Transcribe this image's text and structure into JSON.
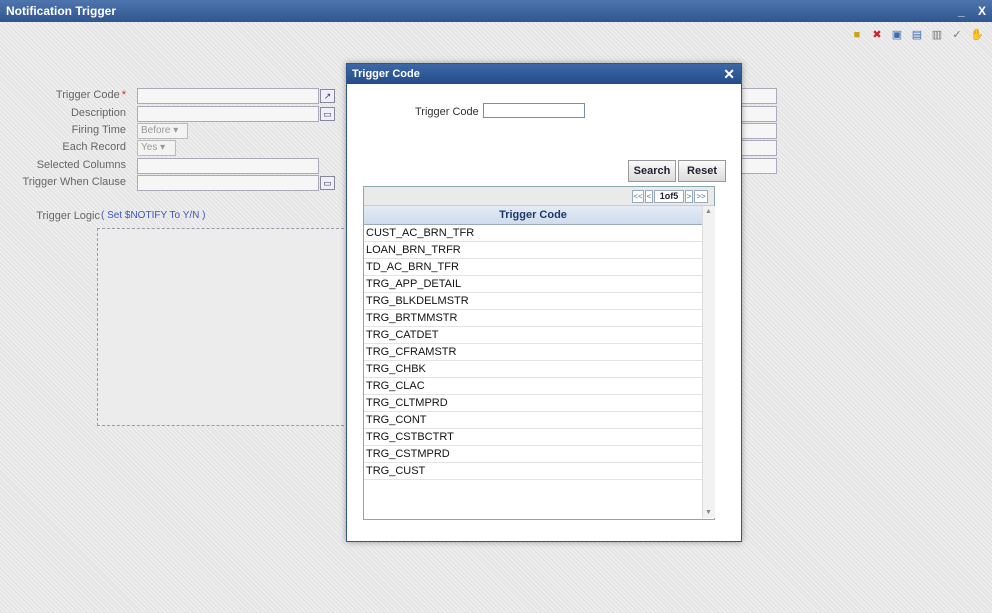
{
  "window": {
    "title": "Notification Trigger",
    "minimize": "_",
    "close": "X"
  },
  "form": {
    "trigger_code_label": "Trigger Code",
    "required_mark": "*",
    "description_label": "Description",
    "firing_time_label": "Firing Time",
    "firing_time_value": "Before",
    "each_record_label": "Each Record",
    "each_record_value": "Yes",
    "selected_columns_label": "Selected Columns",
    "trigger_when_label": "Trigger When Clause",
    "trigger_logic_label": "Trigger Logic",
    "trigger_logic_hint": "( Set $NOTIFY To Y/N )"
  },
  "modal": {
    "title": "Trigger Code",
    "close": "✕",
    "query_label": "Trigger Code",
    "query_value": "",
    "search_label": "Search",
    "reset_label": "Reset",
    "pager": {
      "first": "<<",
      "prev": "<",
      "page_display": "1of5",
      "next": ">",
      "last": ">>"
    },
    "column_header": "Trigger Code",
    "rows": [
      "CUST_AC_BRN_TFR",
      "LOAN_BRN_TRFR",
      "TD_AC_BRN_TFR",
      "TRG_APP_DETAIL",
      "TRG_BLKDELMSTR",
      "TRG_BRTMMSTR",
      "TRG_CATDET",
      "TRG_CFRAMSTR",
      "TRG_CHBK",
      "TRG_CLAC",
      "TRG_CLTMPRD",
      "TRG_CONT",
      "TRG_CSTBCTRT",
      "TRG_CSTMPRD",
      "TRG_CUST"
    ]
  }
}
